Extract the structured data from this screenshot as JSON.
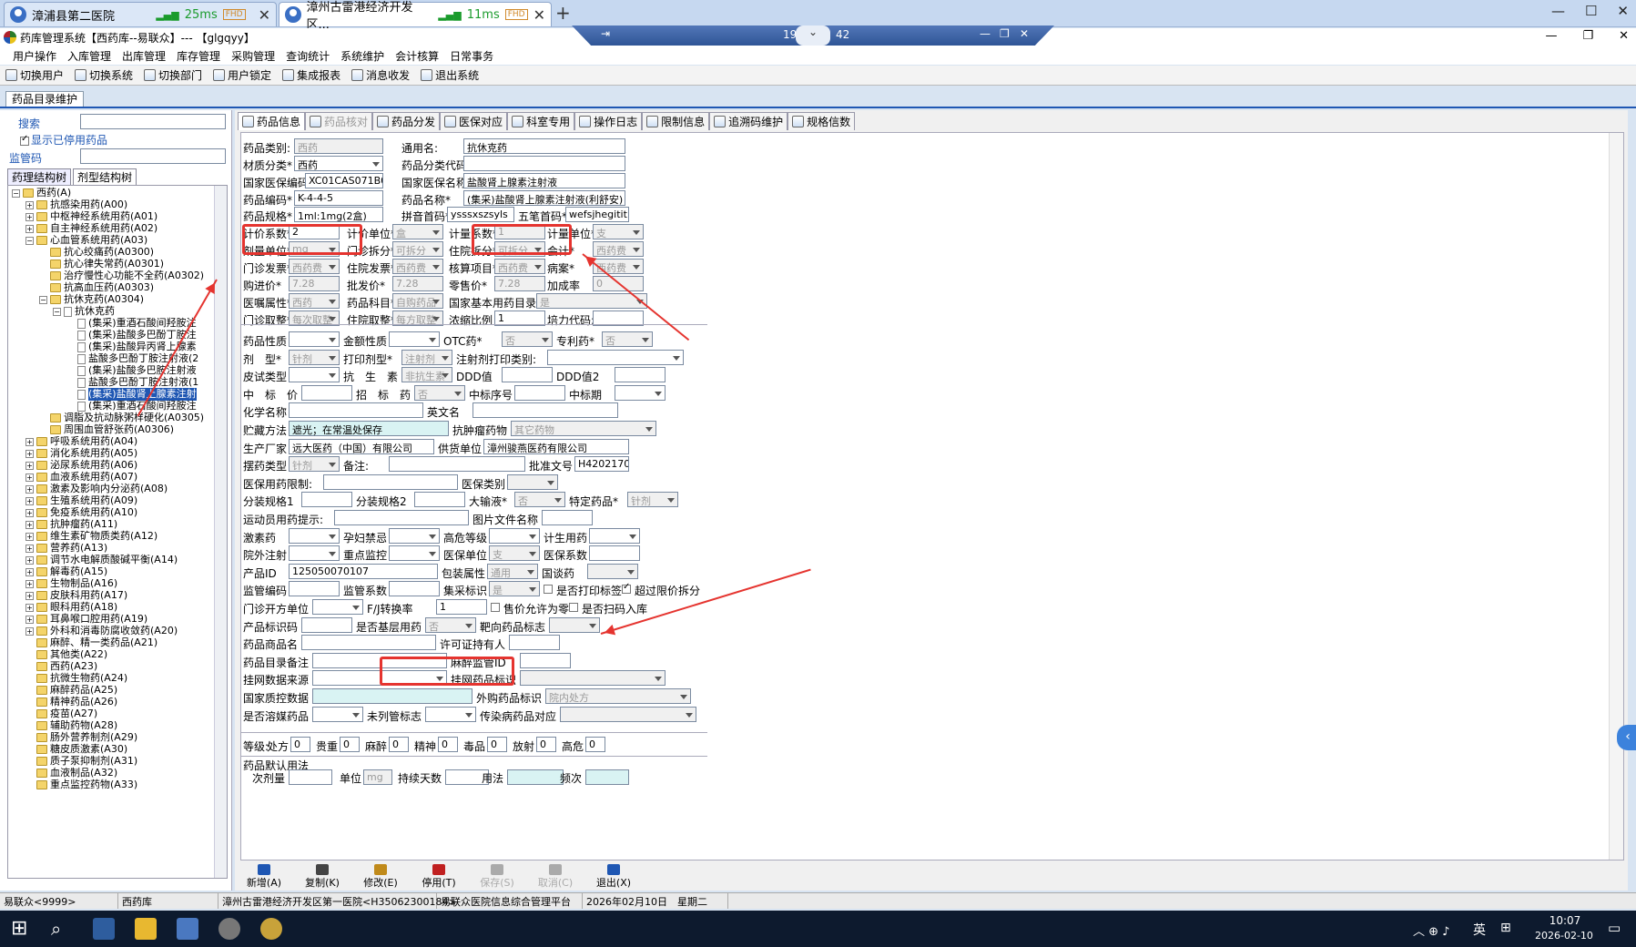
{
  "browser_tabs": [
    {
      "title": "漳浦县第二医院",
      "latency": "25ms",
      "badge": "FHD"
    },
    {
      "title": "漳州古雷港经济开发区...",
      "latency": "11ms",
      "badge": "FHD"
    }
  ],
  "remote_bar": {
    "left": "19",
    "right": "42"
  },
  "app": {
    "title": "药库管理系统【西药库--易联众】--- 【glgqyy】"
  },
  "menu": [
    "用户操作",
    "入库管理",
    "出库管理",
    "库存管理",
    "采购管理",
    "查询统计",
    "系统维护",
    "会计核算",
    "日常事务"
  ],
  "toolbar": [
    "切换用户",
    "切换系统",
    "切换部门",
    "用户锁定",
    "集成报表",
    "消息收发",
    "退出系统"
  ],
  "doc_tab": "药品目录维护",
  "left": {
    "search_label": "搜索",
    "show_disabled": "显示已停用药品",
    "supervise_label": "监管码",
    "tabs": [
      "药理结构树",
      "剂型结构树"
    ],
    "tree": [
      {
        "d": 0,
        "e": "-",
        "f": true,
        "t": "西药(A)"
      },
      {
        "d": 1,
        "e": "+",
        "f": true,
        "t": "抗感染用药(A00)"
      },
      {
        "d": 1,
        "e": "+",
        "f": true,
        "t": "中枢神经系统用药(A01)"
      },
      {
        "d": 1,
        "e": "+",
        "f": true,
        "t": "自主神经系统用药(A02)"
      },
      {
        "d": 1,
        "e": "-",
        "f": true,
        "t": "心血管系统用药(A03)"
      },
      {
        "d": 2,
        "e": "",
        "f": true,
        "t": "抗心绞痛药(A0300)"
      },
      {
        "d": 2,
        "e": "",
        "f": true,
        "t": "抗心律失常药(A0301)"
      },
      {
        "d": 2,
        "e": "",
        "f": true,
        "t": "治疗慢性心功能不全药(A0302)"
      },
      {
        "d": 2,
        "e": "",
        "f": true,
        "t": "抗高血压药(A0303)"
      },
      {
        "d": 2,
        "e": "-",
        "f": true,
        "t": "抗休克药(A0304)"
      },
      {
        "d": 3,
        "e": "-",
        "f": false,
        "t": "抗休克药"
      },
      {
        "d": 4,
        "e": "",
        "f": false,
        "t": "(集采)重酒石酸间羟胺注"
      },
      {
        "d": 4,
        "e": "",
        "f": false,
        "t": "(集采)盐酸多巴酚丁胺注"
      },
      {
        "d": 4,
        "e": "",
        "f": false,
        "t": "(集采)盐酸异丙肾上腺素"
      },
      {
        "d": 4,
        "e": "",
        "f": false,
        "t": "盐酸多巴酚丁胺注射液(2"
      },
      {
        "d": 4,
        "e": "",
        "f": false,
        "t": "(集采)盐酸多巴胺注射液"
      },
      {
        "d": 4,
        "e": "",
        "f": false,
        "t": "盐酸多巴酚丁胺注射液(1"
      },
      {
        "d": 4,
        "e": "",
        "f": false,
        "t": "(集采)盐酸肾上腺素注射",
        "sel": true
      },
      {
        "d": 4,
        "e": "",
        "f": false,
        "t": "(集采)重酒石酸间羟胺注"
      },
      {
        "d": 2,
        "e": "",
        "f": true,
        "t": "调脂及抗动脉粥样硬化(A0305)"
      },
      {
        "d": 2,
        "e": "",
        "f": true,
        "t": "周围血管舒张药(A0306)"
      },
      {
        "d": 1,
        "e": "+",
        "f": true,
        "t": "呼吸系统用药(A04)"
      },
      {
        "d": 1,
        "e": "+",
        "f": true,
        "t": "消化系统用药(A05)"
      },
      {
        "d": 1,
        "e": "+",
        "f": true,
        "t": "泌尿系统用药(A06)"
      },
      {
        "d": 1,
        "e": "+",
        "f": true,
        "t": "血液系统用药(A07)"
      },
      {
        "d": 1,
        "e": "+",
        "f": true,
        "t": "激素及影响内分泌药(A08)"
      },
      {
        "d": 1,
        "e": "+",
        "f": true,
        "t": "生殖系统用药(A09)"
      },
      {
        "d": 1,
        "e": "+",
        "f": true,
        "t": "免疫系统用药(A10)"
      },
      {
        "d": 1,
        "e": "+",
        "f": true,
        "t": "抗肿瘤药(A11)"
      },
      {
        "d": 1,
        "e": "+",
        "f": true,
        "t": "维生素矿物质类药(A12)"
      },
      {
        "d": 1,
        "e": "+",
        "f": true,
        "t": "营养药(A13)"
      },
      {
        "d": 1,
        "e": "+",
        "f": true,
        "t": "调节水电解质酸碱平衡(A14)"
      },
      {
        "d": 1,
        "e": "+",
        "f": true,
        "t": "解毒药(A15)"
      },
      {
        "d": 1,
        "e": "+",
        "f": true,
        "t": "生物制品(A16)"
      },
      {
        "d": 1,
        "e": "+",
        "f": true,
        "t": "皮肤科用药(A17)"
      },
      {
        "d": 1,
        "e": "+",
        "f": true,
        "t": "眼科用药(A18)"
      },
      {
        "d": 1,
        "e": "+",
        "f": true,
        "t": "耳鼻喉口腔用药(A19)"
      },
      {
        "d": 1,
        "e": "+",
        "f": true,
        "t": "外科和消毒防腐收敛药(A20)"
      },
      {
        "d": 1,
        "e": "",
        "f": true,
        "t": "麻醉、精一类药品(A21)"
      },
      {
        "d": 1,
        "e": "",
        "f": true,
        "t": "其他类(A22)"
      },
      {
        "d": 1,
        "e": "",
        "f": true,
        "t": "西药(A23)"
      },
      {
        "d": 1,
        "e": "",
        "f": true,
        "t": "抗微生物药(A24)"
      },
      {
        "d": 1,
        "e": "",
        "f": true,
        "t": "麻醉药品(A25)"
      },
      {
        "d": 1,
        "e": "",
        "f": true,
        "t": "精神药品(A26)"
      },
      {
        "d": 1,
        "e": "",
        "f": true,
        "t": "疫苗(A27)"
      },
      {
        "d": 1,
        "e": "",
        "f": true,
        "t": "辅助药物(A28)"
      },
      {
        "d": 1,
        "e": "",
        "f": true,
        "t": "肠外营养制剂(A29)"
      },
      {
        "d": 1,
        "e": "",
        "f": true,
        "t": "糖皮质激素(A30)"
      },
      {
        "d": 1,
        "e": "",
        "f": true,
        "t": "质子泵抑制剂(A31)"
      },
      {
        "d": 1,
        "e": "",
        "f": true,
        "t": "血液制品(A32)"
      },
      {
        "d": 1,
        "e": "",
        "f": true,
        "t": "重点监控药物(A33)"
      }
    ]
  },
  "right_tabs": [
    {
      "t": "药品信息",
      "on": true
    },
    {
      "t": "药品核对",
      "dis": true
    },
    {
      "t": "药品分发"
    },
    {
      "t": "医保对应"
    },
    {
      "t": "科室专用"
    },
    {
      "t": "操作日志"
    },
    {
      "t": "限制信息"
    },
    {
      "t": "追溯码维护"
    },
    {
      "t": "规格信数"
    }
  ],
  "fields": [
    {
      "l": "药品类别:",
      "v": "西药",
      "r": 0,
      "c": "a",
      "dis": true
    },
    {
      "l": "通用名:",
      "v": "抗休克药",
      "r": 0,
      "c": "b"
    },
    {
      "l": "材质分类*",
      "v": "西药",
      "r": 1,
      "c": "a",
      "cb": true
    },
    {
      "l": "药品分类代码:",
      "v": "",
      "r": 1,
      "c": "b"
    },
    {
      "l": "国家医保编码",
      "v": "XC01CAS071B002C",
      "r": 2,
      "c": "a"
    },
    {
      "l": "国家医保名称",
      "v": "盐酸肾上腺素注射液",
      "r": 2,
      "c": "b"
    },
    {
      "l": "药品编码*",
      "v": "K-4-4-5",
      "r": 3,
      "c": "a"
    },
    {
      "l": "药品名称*",
      "v": "(集采)盐酸肾上腺素注射液(利舒安)",
      "r": 3,
      "c": "b"
    },
    {
      "l": "药品规格*",
      "v": "1ml:1mg(2盒)",
      "r": 4,
      "c": "a"
    },
    {
      "l": "拼音首码*",
      "v": "ysssxszsyls",
      "r": 4,
      "c": "b1"
    },
    {
      "l": "五笔首码*",
      "v": "wefsjhegitit",
      "r": 4,
      "c": "b2"
    }
  ],
  "grid": [
    [
      [
        "计价系数*",
        "2",
        ""
      ],
      [
        "计价单位*",
        "盒",
        "dcb"
      ],
      [
        "计量系数*",
        "1",
        "dis"
      ],
      [
        "计量单位*",
        "支",
        "dcb"
      ]
    ],
    [
      [
        "剂量单位*",
        "mg",
        "dcb"
      ],
      [
        "门诊拆分*",
        "可拆分",
        "dcb"
      ],
      [
        "住院拆分*",
        "可拆分",
        "dcb"
      ],
      [
        "会计*",
        "西药费",
        "dcb"
      ]
    ],
    [
      [
        "门诊发票*",
        "西药费",
        "dcb"
      ],
      [
        "住院发票*",
        "西药费",
        "dcb"
      ],
      [
        "核算项目*",
        "西药费",
        "dcb"
      ],
      [
        "病案*",
        "西药费",
        "dcb"
      ]
    ],
    [
      [
        "购进价*",
        "7.28",
        "dis"
      ],
      [
        "批发价*",
        "7.28",
        "dis"
      ],
      [
        "零售价*",
        "7.28",
        "dis"
      ],
      [
        "加成率",
        "0",
        "dis"
      ]
    ],
    [
      [
        "医嘱属性*",
        "西药",
        "dcb"
      ],
      [
        "药品科目*",
        "自购药品",
        "dcb"
      ],
      [
        "国家基本用药目录",
        "是",
        "dcbw"
      ]
    ],
    [
      [
        "门诊取整*",
        "每次取整",
        "dcb"
      ],
      [
        "住院取整*",
        "每方取整",
        "dcb"
      ],
      [
        "浓缩比例",
        "1",
        ""
      ],
      [
        "培力代码:",
        "",
        ""
      ]
    ]
  ],
  "grid2": [
    [
      [
        "药品性质",
        "",
        "cb"
      ],
      [
        "金额性质",
        "",
        "cb"
      ],
      [
        "OTC药*",
        "否",
        "dcb"
      ],
      [
        "专利药*",
        "否",
        "dcb"
      ]
    ],
    [
      [
        "剂　型*",
        "针剂",
        "dcb"
      ],
      [
        "打印剂型*",
        "注射剂",
        "dcb"
      ],
      [
        "注射剂打印类别:",
        "",
        "cbw"
      ]
    ],
    [
      [
        "皮试类型",
        "",
        "cb"
      ],
      [
        "抗　生　素",
        "非抗生素",
        "dcb"
      ],
      [
        "DDD值",
        "",
        ""
      ],
      [
        "DDD值2",
        "",
        ""
      ]
    ],
    [
      [
        "中　标　价",
        "",
        ""
      ],
      [
        "招　标　药",
        "否",
        "dcb"
      ],
      [
        "中标序号",
        "",
        ""
      ],
      [
        "中标期",
        "",
        "cb"
      ]
    ],
    [
      [
        "化学名称",
        "",
        "w"
      ],
      [
        "英文名",
        "",
        "w"
      ]
    ],
    [
      [
        "贮藏方法",
        "遮光；在常温处保存",
        "blue"
      ],
      [
        "抗肿瘤药物",
        "其它药物",
        "dcbw"
      ]
    ],
    [
      [
        "生产厂家",
        "远大医药（中国）有限公司",
        ""
      ],
      [
        "供货单位",
        "漳州骏燕医药有限公司",
        "w"
      ]
    ],
    [
      [
        "摆药类型",
        "针剂",
        "dcb"
      ],
      [
        "备注:",
        "",
        "w"
      ],
      [
        "批准文号",
        "H42021700",
        ""
      ]
    ],
    [
      [
        "医保用药限制:",
        "",
        "w"
      ],
      [
        "医保类别",
        "",
        "dcb"
      ]
    ],
    [
      [
        "分装规格1",
        "",
        ""
      ],
      [
        "分装规格2",
        "",
        ""
      ],
      [
        "大输液*",
        "否",
        "dcb"
      ],
      [
        "特定药品*",
        "针剂",
        "dcb"
      ]
    ],
    [
      [
        "运动员用药提示:",
        "",
        "w"
      ],
      [
        "图片文件名称",
        "",
        ""
      ]
    ],
    [
      [
        "激素药",
        "",
        "cb"
      ],
      [
        "孕妇禁忌",
        "",
        "cb"
      ],
      [
        "高危等级",
        "",
        "cb"
      ],
      [
        "计生用药",
        "",
        "cb"
      ]
    ],
    [
      [
        "院外注射",
        "",
        "cb"
      ],
      [
        "重点监控",
        "",
        "cb"
      ],
      [
        "医保单位",
        "支",
        "dcb"
      ],
      [
        "医保系数",
        "",
        ""
      ]
    ],
    [
      [
        "产品ID",
        "125050070107",
        ""
      ],
      [
        "包装属性",
        "通用",
        "dcb"
      ],
      [
        "国谈药",
        "",
        "dcb"
      ]
    ],
    [
      [
        "监管编码",
        "",
        ""
      ],
      [
        "监管系数",
        "",
        ""
      ],
      [
        "集采标识",
        "是",
        "dcb"
      ],
      [
        "是否打印标签",
        "",
        "ck"
      ],
      [
        "超过限价拆分",
        "",
        "ckon"
      ]
    ],
    [
      [
        "门诊开方单位",
        "",
        "cb"
      ],
      [
        "F/J转换率",
        "1",
        ""
      ],
      [
        "售价允许为零",
        "",
        "ck"
      ],
      [
        "是否扫码入库",
        "",
        "ck"
      ]
    ],
    [
      [
        "产品标识码",
        "",
        ""
      ],
      [
        "是否基层用药",
        "否",
        "dcb"
      ],
      [
        "靶向药品标志",
        "",
        "dcb"
      ]
    ],
    [
      [
        "药品商品名",
        "",
        "w"
      ],
      [
        "许可证持有人",
        "",
        ""
      ]
    ],
    [
      [
        "药品目录备注",
        "",
        "w"
      ],
      [
        "麻醉监管ID",
        "",
        ""
      ]
    ],
    [
      [
        "挂网数据来源",
        "",
        "cbw"
      ],
      [
        "挂网药品标识",
        "",
        "dcbw"
      ]
    ],
    [
      [
        "国家质控数据",
        "",
        "blue"
      ],
      [
        "外购药品标识",
        "院内处方",
        "dcbw"
      ]
    ],
    [
      [
        "是否溶媒药品",
        "",
        "cb"
      ],
      [
        "未列管标志",
        "",
        "cb"
      ],
      [
        "传染病药品对应",
        "",
        "dcbw"
      ]
    ]
  ],
  "grades": {
    "label": "等级:",
    "items": [
      [
        "处方",
        "0"
      ],
      [
        "贵重",
        "0"
      ],
      [
        "麻醉",
        "0"
      ],
      [
        "精神",
        "0"
      ],
      [
        "毒品",
        "0"
      ],
      [
        "放射",
        "0"
      ],
      [
        "高危",
        "0"
      ]
    ]
  },
  "usage": {
    "label": "药品默认用法",
    "items": [
      "次剂量",
      "单位",
      "mg",
      "持续天数",
      "用法",
      "频次"
    ]
  },
  "buttons": [
    {
      "t": "新增(A)",
      "c": "#1f57b3"
    },
    {
      "t": "复制(K)",
      "c": "#444"
    },
    {
      "t": "修改(E)",
      "c": "#c08a1a"
    },
    {
      "t": "停用(T)",
      "c": "#c02020"
    },
    {
      "t": "保存(S)",
      "c": "#aaa",
      "dis": true
    },
    {
      "t": "取消(C)",
      "c": "#aaa",
      "dis": true
    },
    {
      "t": "退出(X)",
      "c": "#1f57b3"
    }
  ],
  "status": [
    "易联众<9999>",
    "西药库",
    "漳州古雷港经济开发区第一医院<H35062300184>",
    "易联众医院信息综合管理平台",
    "2026年02月10日　星期二"
  ],
  "clock": {
    "time": "10:07",
    "date": "2026-02-10",
    "ime": "英"
  }
}
